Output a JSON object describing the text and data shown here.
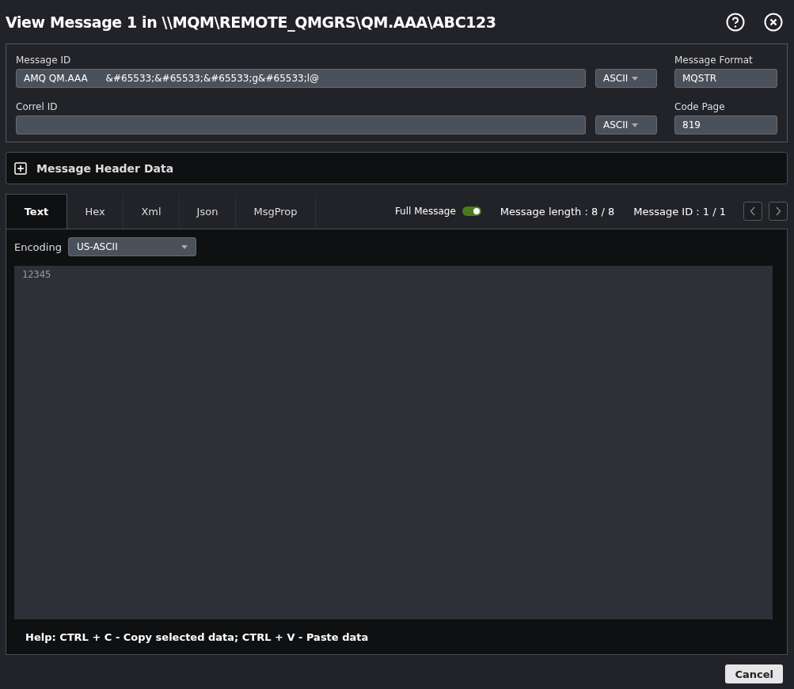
{
  "window": {
    "title": "View Message 1 in \\\\MQM\\REMOTE_QMGRS\\QM.AAA\\ABC123"
  },
  "fields": {
    "message_id": {
      "label": "Message ID",
      "value": "AMQ QM.AAA      &#65533;&#65533;&#65533;g&#65533;l@",
      "encoding": "ASCII"
    },
    "correl_id": {
      "label": "Correl ID",
      "encoding": "ASCII"
    },
    "message_format": {
      "label": "Message Format",
      "value": "MQSTR"
    },
    "code_page": {
      "label": "Code Page",
      "value": "819"
    }
  },
  "header_section": {
    "title": "Message Header Data",
    "expanded": false
  },
  "tabs": [
    {
      "label": "Text",
      "selected": true
    },
    {
      "label": "Hex",
      "selected": false
    },
    {
      "label": "Xml",
      "selected": false
    },
    {
      "label": "Json",
      "selected": false
    },
    {
      "label": "MsgProp",
      "selected": false
    }
  ],
  "full_message": {
    "label": "Full Message",
    "on": true
  },
  "message_length": "Message length : 8 / 8",
  "message_position": "Message ID : 1 / 1",
  "encoding": {
    "label": "Encoding",
    "value": "US-ASCII"
  },
  "editor": {
    "content": "12345"
  },
  "help": "Help: CTRL + C - Copy selected data; CTRL + V - Paste data",
  "buttons": [
    "Cancel"
  ]
}
